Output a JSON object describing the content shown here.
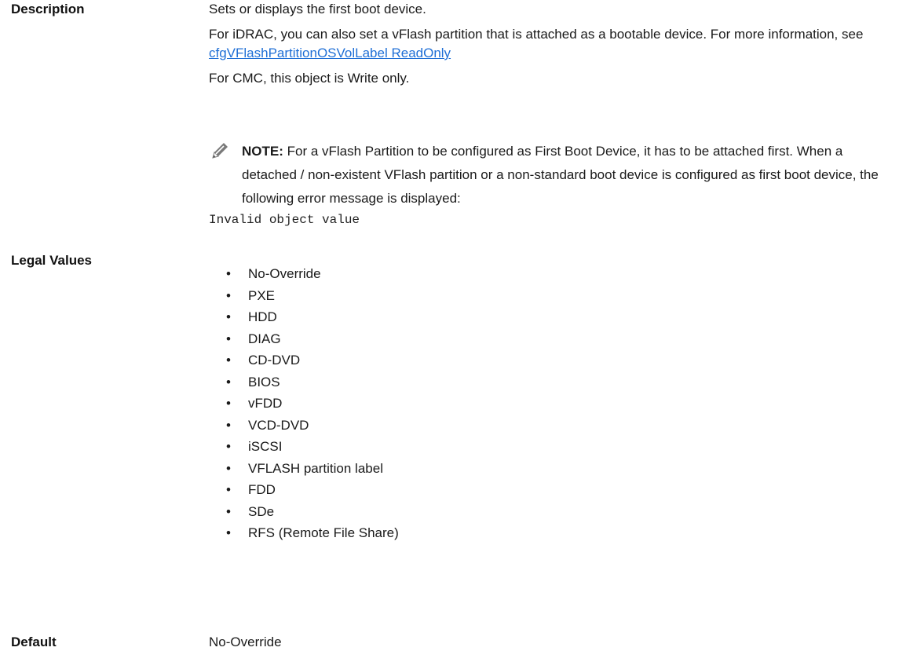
{
  "description": {
    "label": "Description",
    "line1": "Sets or displays the first boot device.",
    "line2_text": "For iDRAC, you can also set a vFlash partition that is attached as a bootable device. For more information, see ",
    "line2_link": "cfgVFlashPartitionOSVolLabel ReadOnly",
    "line3": "For CMC, this object is Write only."
  },
  "note": {
    "icon": "pencil-note-icon",
    "label": "NOTE:",
    "text": " For a vFlash Partition to be configured as First Boot Device, it has to be attached first. When a detached / non-existent VFlash partition or a non-standard boot device is configured as first boot device, the following error message is displayed:"
  },
  "error_message": "Invalid object value",
  "legal_values": {
    "label": "Legal Values",
    "items": [
      "No-Override",
      "PXE",
      "HDD",
      "DIAG",
      "CD-DVD",
      "BIOS",
      "vFDD",
      "VCD-DVD",
      "iSCSI",
      "VFLASH partition label",
      "FDD",
      "SDe",
      "RFS (Remote File Share)"
    ]
  },
  "default": {
    "label": "Default",
    "value": "No-Override"
  },
  "colors": {
    "link": "#1f6fd6",
    "text": "#1a1a1a"
  }
}
